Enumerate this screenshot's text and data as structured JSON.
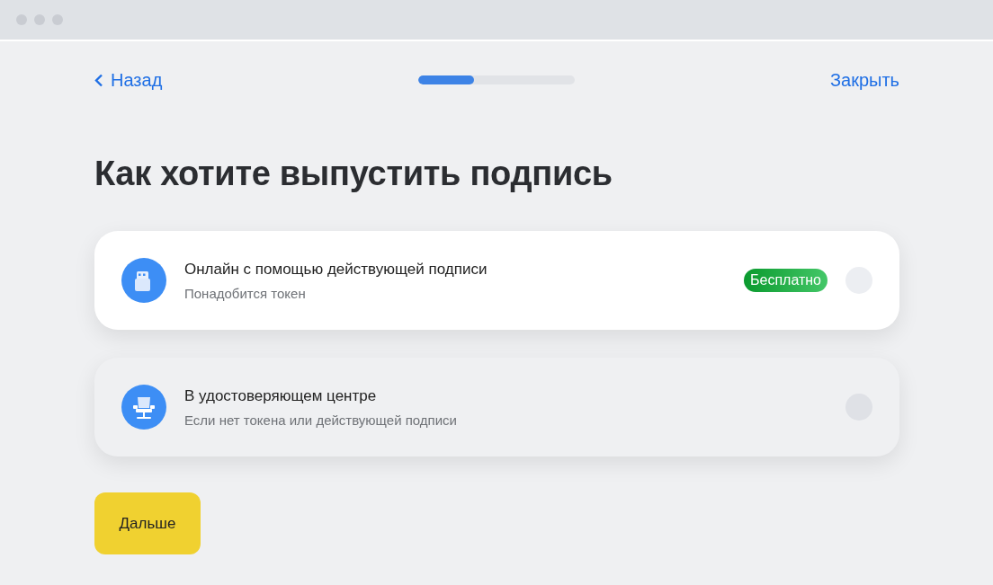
{
  "nav": {
    "back": "Назад",
    "close": "Закрыть",
    "progress": {
      "level": 0.36
    }
  },
  "title": "Как хотите выпустить подпись",
  "options": [
    {
      "kind": "token",
      "title": "Онлайн с помощью действующей подписи",
      "subtitle": "Понадобится токен",
      "badge": "Бесплатно",
      "highlighted": true,
      "selected": false
    },
    {
      "kind": "office",
      "title": "В удостоверяющем центре",
      "subtitle": "Если нет токена или действующей подписи",
      "highlighted": false,
      "selected": false
    }
  ],
  "next_button": "Дальше"
}
